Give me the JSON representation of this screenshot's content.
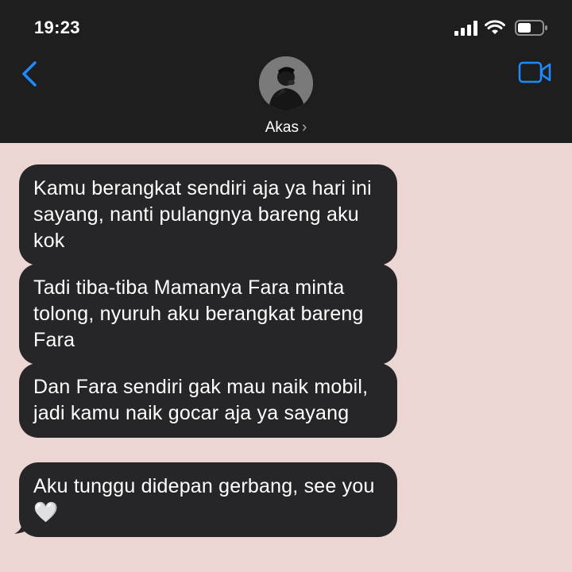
{
  "status_bar": {
    "time": "19:23",
    "icons": [
      "cellular-signal-icon",
      "wifi-icon",
      "battery-icon"
    ]
  },
  "header": {
    "contact_name": "Akas",
    "chevron": "›",
    "back_icon": "chevron-left-icon",
    "video_icon": "video-camera-icon",
    "accent_color": "#1c8bff"
  },
  "colors": {
    "header_bg": "#1e1e1f",
    "chat_bg": "#ecd6d4",
    "bubble_bg": "#262628",
    "bubble_text": "#ffffff"
  },
  "messages": [
    {
      "sender": "Akas",
      "text": "Kamu berangkat sendiri aja ya hari ini sayang, nanti pulangnya bareng aku kok"
    },
    {
      "sender": "Akas",
      "text": "Tadi tiba-tiba Mamanya Fara minta tolong, nyuruh aku berangkat bareng Fara"
    },
    {
      "sender": "Akas",
      "text": "Dan Fara sendiri gak mau naik mobil, jadi kamu naik gocar aja ya sayang"
    },
    {
      "sender": "Akas",
      "text": "Aku tunggu didepan gerbang, see you🤍"
    }
  ]
}
